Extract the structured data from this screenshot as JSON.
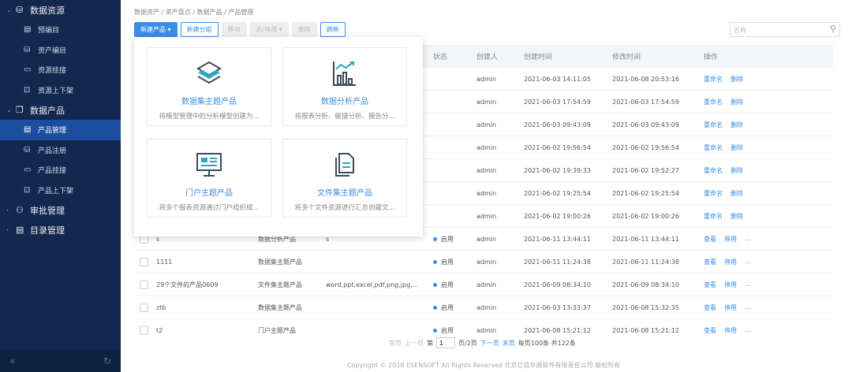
{
  "sidebar": {
    "groups": [
      {
        "label": "数据资源",
        "items": [
          "预编目",
          "资产编目",
          "资源挂接",
          "资源上下架"
        ]
      },
      {
        "label": "数据产品",
        "items": [
          "产品管理",
          "产品注册",
          "产品挂接",
          "产品上下架"
        ]
      },
      {
        "label": "审批管理"
      },
      {
        "label": "目录管理"
      }
    ],
    "active": "产品管理",
    "collapse_icon": "«",
    "refresh_icon": "↻"
  },
  "breadcrumb": "数据资产 / 资产盘点  /  数据产品  /  产品管理",
  "toolbar": {
    "new_product": "新建产品",
    "new_group": "新建分组",
    "move": "移动",
    "enable_disable": "启/停用",
    "delete": "删除",
    "refresh": "刷新"
  },
  "search": {
    "placeholder": "名称"
  },
  "popover": {
    "cards": [
      {
        "title": "数据集主题产品",
        "desc": "将模型管理中的分析模型创建为..."
      },
      {
        "title": "数据分析产品",
        "desc": "将报表分析、敏捷分析、报告分..."
      },
      {
        "title": "门户主题产品",
        "desc": "将多个报表资源通过门户组织成..."
      },
      {
        "title": "文件集主题产品",
        "desc": "将多个文件资源进行汇总创建文..."
      }
    ]
  },
  "table": {
    "headers": {
      "status": "状态",
      "creator": "创建人",
      "created": "创建时间",
      "modified": "修改时间",
      "ops": "操作"
    },
    "group_rows": [
      {
        "creator": "admin",
        "created": "2021-06-03 14:11:05",
        "modified": "2021-06-08 20:53:16",
        "ops": [
          "重命名",
          "删除"
        ]
      },
      {
        "creator": "admin",
        "created": "2021-06-03 17:54:59",
        "modified": "2021-06-03 17:54:59",
        "ops": [
          "重命名",
          "删除"
        ]
      },
      {
        "creator": "admin",
        "created": "2021-06-03 09:43:09",
        "modified": "2021-06-03 09:43:09",
        "ops": [
          "重命名",
          "删除"
        ]
      },
      {
        "creator": "admin",
        "created": "2021-06-02 19:56:54",
        "modified": "2021-06-02 19:56:54",
        "ops": [
          "重命名",
          "删除"
        ]
      },
      {
        "creator": "admin",
        "created": "2021-06-02 19:39:33",
        "modified": "2021-06-02 19:52:27",
        "ops": [
          "重命名",
          "删除"
        ]
      },
      {
        "creator": "admin",
        "created": "2021-06-02 19:25:54",
        "modified": "2021-06-02 19:25:54",
        "ops": [
          "重命名",
          "删除"
        ]
      },
      {
        "creator": "admin",
        "created": "2021-06-02 19:00:26",
        "modified": "2021-06-02 19:00:26",
        "ops": [
          "重命名",
          "删除"
        ]
      }
    ],
    "rows": [
      {
        "name": "s",
        "type": "数据分析产品",
        "desc": "s",
        "status": "启用",
        "creator": "admin",
        "created": "2021-06-11 13:44:11",
        "modified": "2021-06-11 13:44:11",
        "ops": [
          "查看",
          "停用",
          "..."
        ]
      },
      {
        "name": "1111",
        "type": "数据集主题产品",
        "desc": "",
        "status": "启用",
        "creator": "admin",
        "created": "2021-06-11 11:24:38",
        "modified": "2021-06-11 11:24:38",
        "ops": [
          "查看",
          "停用",
          "..."
        ]
      },
      {
        "name": "29个文件的产品0609",
        "type": "文件集主题产品",
        "desc": "word,ppt,excel,pdf,png,jpg,...",
        "status": "启用",
        "creator": "admin",
        "created": "2021-06-09 08:34:10",
        "modified": "2021-06-09 08:34:10",
        "ops": [
          "查看",
          "停用",
          "..."
        ]
      },
      {
        "name": "ztb",
        "type": "数据集主题产品",
        "desc": "",
        "status": "启用",
        "creator": "admin",
        "created": "2021-06-03 13:33:37",
        "modified": "2021-06-08 15:32:35",
        "ops": [
          "查看",
          "停用",
          "..."
        ]
      },
      {
        "name": "t2",
        "type": "门户主题产品",
        "desc": "",
        "status": "启用",
        "creator": "admin",
        "created": "2021-06-08 15:21:12",
        "modified": "2021-06-08 15:21:12",
        "ops": [
          "查看",
          "停用",
          "..."
        ]
      }
    ]
  },
  "pager": {
    "first": "首页",
    "prev": "上一页",
    "page_prefix": "第",
    "page": "1",
    "page_suffix": "页/2页",
    "next": "下一页",
    "last": "末页",
    "summary": "每页100条 共122条"
  },
  "footer": "Copyright © 2018 ESENSOFT All Rights Reserved 北京亿信华辰软件有限责任公司 版权所有"
}
